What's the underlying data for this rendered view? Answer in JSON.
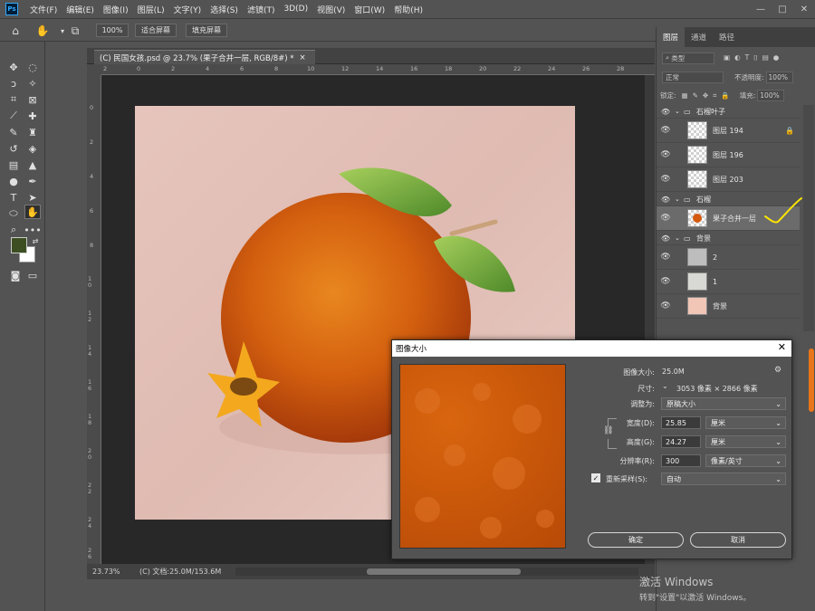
{
  "app": {
    "logo_text": "Ps"
  },
  "menu": [
    "文件(F)",
    "编辑(E)",
    "图像(I)",
    "图层(L)",
    "文字(Y)",
    "选择(S)",
    "滤镜(T)",
    "3D(D)",
    "视图(V)",
    "窗口(W)",
    "帮助(H)"
  ],
  "window_controls": {
    "minimize": "—",
    "maximize": "□",
    "close": "✕"
  },
  "options_bar": {
    "zoom_value": "100%",
    "fit_screen": "适合屏幕",
    "fill_screen": "填充屏幕"
  },
  "document": {
    "tab_title": "(C) 民国女孩.psd @ 23.7% (果子合并一层, RGB/8#) *",
    "tab_close": "×",
    "zoom": "23.73%",
    "doc_info": "(C) 文档:25.0M/153.6M",
    "ruler_top_labels": [
      "2",
      "0",
      "2",
      "4",
      "6",
      "8",
      "10",
      "12",
      "14",
      "16",
      "18",
      "20",
      "22",
      "24",
      "26",
      "28"
    ],
    "ruler_left_labels": [
      "0",
      "2",
      "4",
      "6",
      "8",
      "1 0",
      "1 2",
      "1 4",
      "1 6",
      "1 8",
      "2 0",
      "2 2",
      "2 4",
      "2 6"
    ]
  },
  "layers_panel": {
    "tabs": [
      "图层",
      "通道",
      "路径"
    ],
    "search_placeholder": "类型",
    "blend_mode": "正常",
    "opacity_label": "不透明度:",
    "opacity_value": "100%",
    "lock_label": "锁定:",
    "fill_label": "填充:",
    "fill_value": "100%",
    "items": [
      {
        "kind": "group",
        "name": "石榴叶子"
      },
      {
        "kind": "layer",
        "name": "图层 194",
        "locked": true
      },
      {
        "kind": "layer",
        "name": "图层 196",
        "locked": false
      },
      {
        "kind": "layer",
        "name": "图层 203",
        "locked": false
      },
      {
        "kind": "group",
        "name": "石榴"
      },
      {
        "kind": "layer",
        "name": "果子合并一层",
        "locked": false,
        "selected": true
      },
      {
        "kind": "group",
        "name": "背景"
      },
      {
        "kind": "layer",
        "name": "2",
        "locked": false
      },
      {
        "kind": "layer",
        "name": "1",
        "locked": false
      },
      {
        "kind": "layer",
        "name": "背景",
        "locked": false
      }
    ]
  },
  "dialog": {
    "title": "图像大小",
    "close": "✕",
    "image_size_label": "图像大小:",
    "image_size_value": "25.0M",
    "dimensions_label": "尺寸:",
    "dimensions_value": "3053 像素 × 2866 像素",
    "fit_label": "调整为:",
    "fit_value": "原稿大小",
    "width_label": "宽度(D):",
    "width_value": "25.85",
    "width_unit": "厘米",
    "height_label": "高度(G):",
    "height_value": "24.27",
    "height_unit": "厘米",
    "resolution_label": "分辨率(R):",
    "resolution_value": "300",
    "resolution_unit": "像素/英寸",
    "resample_label": "重新采样(S):",
    "resample_value": "自动",
    "ok": "确定",
    "cancel": "取消"
  },
  "watermark": {
    "line1": "激活 Windows",
    "line2": "转到\"设置\"以激活 Windows。"
  },
  "colors": {
    "foreground": "#3d4f22",
    "background": "#ffffff",
    "accent_check": "#ffe600",
    "fruit": "#d45a10"
  }
}
